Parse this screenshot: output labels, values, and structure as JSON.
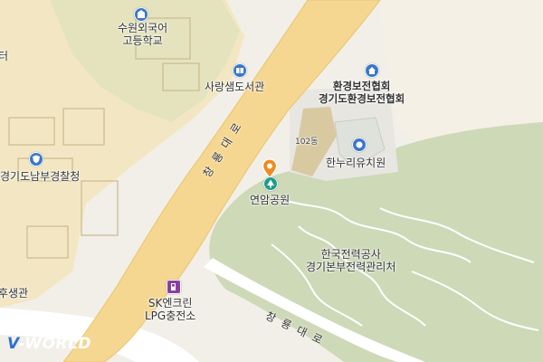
{
  "map": {
    "pois": [
      {
        "id": "school",
        "label_lines": [
          "수원외국어",
          "고등학교"
        ],
        "icon": "school-icon"
      },
      {
        "id": "library",
        "label_lines": [
          "사랑샘도서관"
        ],
        "icon": "library-icon"
      },
      {
        "id": "env_assoc",
        "label_lines": [
          "환경보전협회",
          "경기도환경보전협회"
        ],
        "icon": "office-icon"
      },
      {
        "id": "kindergarten",
        "label_lines": [
          "한누리유치원"
        ],
        "icon": "kindergarten-icon"
      },
      {
        "id": "park",
        "label_lines": [
          "연암공원"
        ],
        "icon": "park-icon"
      },
      {
        "id": "police",
        "label_lines": [
          "경기도남부경찰청"
        ],
        "icon": "police-icon"
      },
      {
        "id": "kepco",
        "label_lines": [
          "한국전력공사",
          "경기본부전력관리처"
        ],
        "icon": null
      },
      {
        "id": "lpg",
        "label_lines": [
          "SK엔크린",
          "LPG충전소"
        ],
        "icon": "gas-station-icon"
      },
      {
        "id": "welfare",
        "label_lines": [
          "후생관"
        ],
        "icon": null
      },
      {
        "id": "edge_top",
        "label_lines": [
          "터"
        ],
        "icon": null
      }
    ],
    "building_label": "102동",
    "roads": [
      {
        "id": "road_upper",
        "name": "창 룡 대 로"
      },
      {
        "id": "road_lower",
        "name": "창 룡 대 로"
      }
    ],
    "logo": {
      "prefix": "V",
      "rest": "-WORLD"
    },
    "colors": {
      "road_main": "#f5d791",
      "park": "#cdd9b7",
      "campus": "#f3e7c3",
      "building": "#d9c9a0"
    }
  }
}
